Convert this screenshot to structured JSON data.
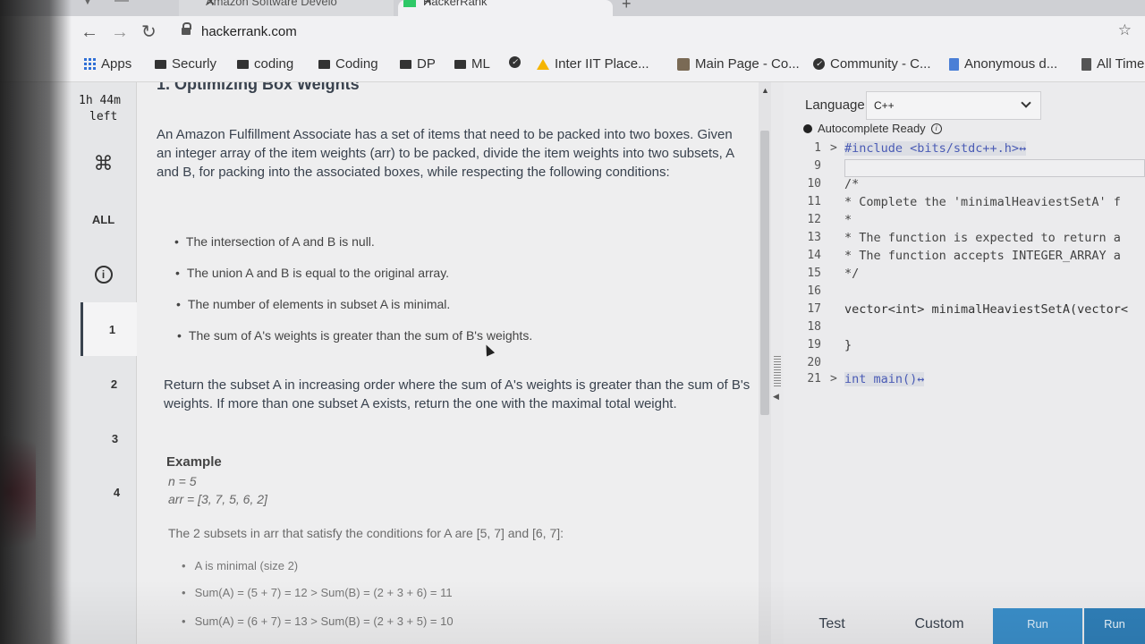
{
  "browser": {
    "tabs": [
      {
        "label": "Amazon Software Develo"
      },
      {
        "label": "HackerRank"
      }
    ],
    "url": "hackerrank.com",
    "bookmarks": [
      {
        "label": "Apps"
      },
      {
        "label": "Securly"
      },
      {
        "label": "coding"
      },
      {
        "label": "Coding"
      },
      {
        "label": "DP"
      },
      {
        "label": "ML"
      },
      {
        "label": "Inter IIT Place..."
      },
      {
        "label": "Main Page - Co..."
      },
      {
        "label": "Community - C..."
      },
      {
        "label": "Anonymous d..."
      },
      {
        "label": "All Time"
      }
    ]
  },
  "rail": {
    "timer_line1": "1h 44m",
    "timer_line2": "left",
    "all_label": "ALL",
    "questions": [
      "1",
      "2",
      "3",
      "4"
    ]
  },
  "problem": {
    "title": "1. Optimizing Box Weights",
    "intro": "An Amazon Fulfillment Associate has a set of items that need to be packed into two boxes. Given an integer array of the item weights (arr) to be packed, divide the item weights into two subsets, A and B, for packing into the associated boxes, while respecting the following conditions:",
    "conditions": [
      "The intersection of A and B is null.",
      "The union A and B is equal to the original array.",
      "The number of elements in subset A is minimal.",
      "The sum of A's weights is greater than the sum of B's weights."
    ],
    "return_text": "Return the subset A in increasing order where the sum of A's weights is greater than the sum of B's weights. If more than one subset A exists, return the one with the maximal total weight.",
    "example_heading": "Example",
    "example_n": "n = 5",
    "example_arr": "arr = [3, 7, 5, 6, 2]",
    "subsets_text": "The 2 subsets in arr that satisfy the conditions for A are [5, 7] and [6, 7]:",
    "subset_points": [
      "A is minimal (size 2)",
      "Sum(A) = (5 + 7) = 12 > Sum(B) = (2 + 3 + 6) = 11",
      "Sum(A) = (6 + 7) = 13 > Sum(B) = (2 + 3 + 5) = 10"
    ]
  },
  "editor": {
    "language_label": "Language",
    "language_value": "C++",
    "autocomplete": "Autocomplete Ready",
    "lines": [
      {
        "num": "1",
        "fold": ">",
        "text": "#include <bits/stdc++.h>↔"
      },
      {
        "num": "9",
        "fold": "",
        "text": ""
      },
      {
        "num": "10",
        "fold": "",
        "text": "/*"
      },
      {
        "num": "11",
        "fold": "",
        "text": " * Complete the 'minimalHeaviestSetA' f"
      },
      {
        "num": "12",
        "fold": "",
        "text": " *"
      },
      {
        "num": "13",
        "fold": "",
        "text": " * The function is expected to return a"
      },
      {
        "num": "14",
        "fold": "",
        "text": " * The function accepts INTEGER_ARRAY a"
      },
      {
        "num": "15",
        "fold": "",
        "text": " */"
      },
      {
        "num": "16",
        "fold": "",
        "text": ""
      },
      {
        "num": "17",
        "fold": "",
        "text": "vector<int> minimalHeaviestSetA(vector<"
      },
      {
        "num": "18",
        "fold": "",
        "text": ""
      },
      {
        "num": "19",
        "fold": "",
        "text": "}"
      },
      {
        "num": "20",
        "fold": "",
        "text": ""
      },
      {
        "num": "21",
        "fold": ">",
        "text": "int main()↔"
      }
    ]
  },
  "actions": {
    "test": "Test",
    "custom": "Custom",
    "run": "Run",
    "run2": "Run"
  }
}
